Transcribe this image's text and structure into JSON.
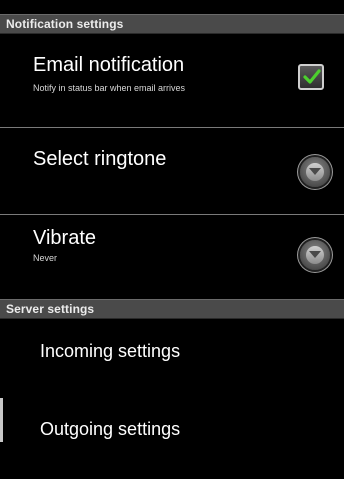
{
  "notification_settings": {
    "header": "Notification settings",
    "email_notification": {
      "title": "Email notification",
      "summary": "Notify in status bar when email arrives",
      "checked": true
    },
    "select_ringtone": {
      "title": "Select ringtone"
    },
    "vibrate": {
      "title": "Vibrate",
      "summary": "Never"
    }
  },
  "server_settings": {
    "header": "Server settings",
    "incoming": {
      "title": "Incoming settings"
    },
    "outgoing": {
      "title": "Outgoing settings"
    }
  },
  "colors": {
    "checkmark": "#4cd02e",
    "section_header_bg": "#4a4a4a"
  }
}
